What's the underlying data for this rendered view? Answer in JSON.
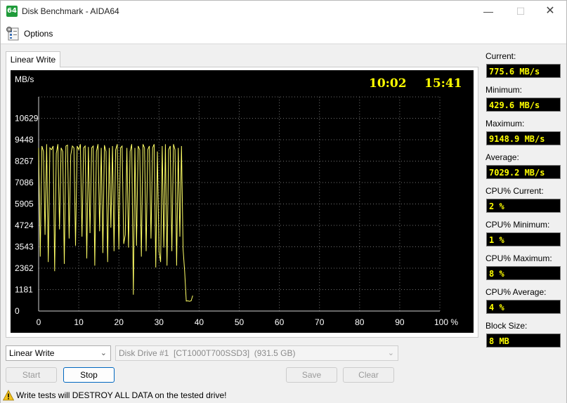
{
  "window": {
    "title": "Disk Benchmark - AIDA64",
    "app_icon_text": "64",
    "minimize": "—",
    "maximize": "☐",
    "close": "✕"
  },
  "menu": {
    "options_label": "Options"
  },
  "tab": {
    "label": "Linear Write"
  },
  "chart_data": {
    "type": "line",
    "ylabel": "MB/s",
    "yticks": [
      0,
      1181,
      2362,
      3543,
      4724,
      5905,
      7086,
      8267,
      9448,
      10629
    ],
    "ylim": [
      0,
      11810
    ],
    "xticks": [
      0,
      10,
      20,
      30,
      40,
      50,
      60,
      70,
      80,
      90,
      100
    ],
    "xtick_labels": [
      "0",
      "10",
      "20",
      "30",
      "40",
      "50",
      "60",
      "70",
      "80",
      "90",
      "100 %"
    ],
    "xlim": [
      0,
      100
    ],
    "grid": true,
    "time_elapsed": "10:02",
    "time_total": "15:41",
    "colors": {
      "background": "#000000",
      "line": "#ffff66",
      "grid": "#707070",
      "text": "#ffffff",
      "time": "#ffff00"
    },
    "series": [
      {
        "x": [
          0,
          0.4,
          0.8,
          1.2,
          1.6,
          2.0,
          2.4,
          2.8,
          3.2,
          3.6,
          4.0,
          4.4,
          4.8,
          5.2,
          5.6,
          6.0,
          6.4,
          6.8,
          7.2,
          7.6,
          8.0,
          8.4,
          8.8,
          9.2,
          9.6,
          10.0,
          10.4,
          10.8,
          11.2,
          11.6,
          12.0,
          12.4,
          12.8,
          13.2,
          13.6,
          14.0,
          14.4,
          14.8,
          15.2,
          15.6,
          16.0,
          16.4,
          16.8,
          17.2,
          17.6,
          18.0,
          18.4,
          18.8,
          19.2,
          19.6,
          20.0,
          20.4,
          20.8,
          21.2,
          21.6,
          22.0,
          22.4,
          22.8,
          23.2,
          23.6,
          24.0,
          24.4,
          24.8,
          25.2,
          25.6,
          26.0,
          26.4,
          26.8,
          27.2,
          27.6,
          28.0,
          28.4,
          28.8,
          29.2,
          29.6,
          30.0,
          30.4,
          30.8,
          31.2,
          31.6,
          32.0,
          32.4,
          32.8,
          33.2,
          33.6,
          34.0,
          34.4,
          34.8,
          35.2,
          35.6,
          36.0,
          36.4,
          36.8,
          37.2,
          37.6,
          38.0,
          38.4
        ],
        "y": [
          9000,
          3000,
          9100,
          8800,
          4200,
          9200,
          2700,
          9000,
          8900,
          9100,
          2200,
          8700,
          9200,
          4500,
          9000,
          8800,
          2600,
          9100,
          9150,
          4000,
          8600,
          9100,
          9000,
          3600,
          9100,
          8900,
          9200,
          4100,
          9000,
          9100,
          2900,
          9050,
          4300,
          9000,
          9100,
          2500,
          8800,
          9200,
          4400,
          9000,
          3200,
          9150,
          8800,
          2700,
          9000,
          4600,
          9100,
          3300,
          8900,
          9200,
          3400,
          9000,
          9100,
          3700,
          4200,
          9000,
          3500,
          8800,
          9200,
          900,
          9000,
          3600,
          9100,
          8900,
          3000,
          9200,
          9000,
          3300,
          8900,
          9100,
          4000,
          9000,
          9200,
          2400,
          8800,
          3300,
          2700,
          9100,
          3500,
          9200,
          2500,
          8900,
          9100,
          3300,
          9200,
          8900,
          2500,
          9000,
          4100,
          9100,
          3400,
          2200,
          550,
          560,
          540,
          560,
          850
        ]
      }
    ]
  },
  "stats": [
    {
      "label": "Current:",
      "value": "775.6 MB/s"
    },
    {
      "label": "Minimum:",
      "value": "429.6 MB/s"
    },
    {
      "label": "Maximum:",
      "value": "9148.9 MB/s"
    },
    {
      "label": "Average:",
      "value": "7029.2 MB/s"
    },
    {
      "label": "CPU% Current:",
      "value": "2 %"
    },
    {
      "label": "CPU% Minimum:",
      "value": "1 %"
    },
    {
      "label": "CPU% Maximum:",
      "value": "8 %"
    },
    {
      "label": "CPU% Average:",
      "value": "4 %"
    },
    {
      "label": "Block Size:",
      "value": "8 MB"
    }
  ],
  "controls": {
    "test_select": "Linear Write",
    "drive_select": "Disk Drive #1  [CT1000T700SSD3]  (931.5 GB)",
    "start": "Start",
    "stop": "Stop",
    "save": "Save",
    "clear": "Clear"
  },
  "status": {
    "warning": "Write tests will DESTROY ALL DATA on the tested drive!"
  }
}
